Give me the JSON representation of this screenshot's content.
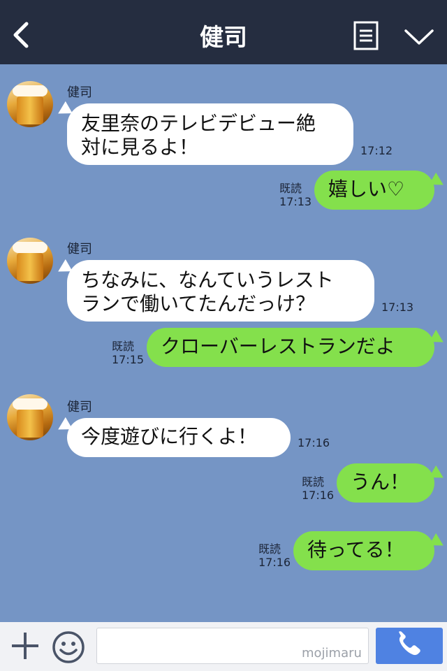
{
  "header": {
    "title": "健司"
  },
  "messages": [
    {
      "sender": "健司",
      "text_line1": "友里奈のテレビデビュー絶",
      "text_line2": "対に見るよ！",
      "time": "17:12"
    },
    {
      "text": "嬉しい♡",
      "read": "既読",
      "time": "17:13"
    },
    {
      "sender": "健司",
      "text_line1": "ちなみに、なんていうレスト",
      "text_line2": "ランで働いてたんだっけ？",
      "time": "17:13"
    },
    {
      "text": "クローバーレストランだよ",
      "read": "既読",
      "time": "17:15"
    },
    {
      "sender": "健司",
      "text": "今度遊びに行くよ！",
      "time": "17:16"
    },
    {
      "text": "うん！",
      "read": "既読",
      "time": "17:16"
    },
    {
      "text": "待ってる！",
      "read": "既読",
      "time": "17:16"
    }
  ],
  "input": {
    "watermark": "mojimaru"
  },
  "colors": {
    "header": "#252d40",
    "background": "#7595c5",
    "incoming": "#ffffff",
    "outgoing": "#84e04c",
    "send": "#4f82e2"
  },
  "icons": [
    "back-icon",
    "menu-icon",
    "chevron-down-icon",
    "plus-icon",
    "emoji-icon",
    "phone-icon"
  ]
}
